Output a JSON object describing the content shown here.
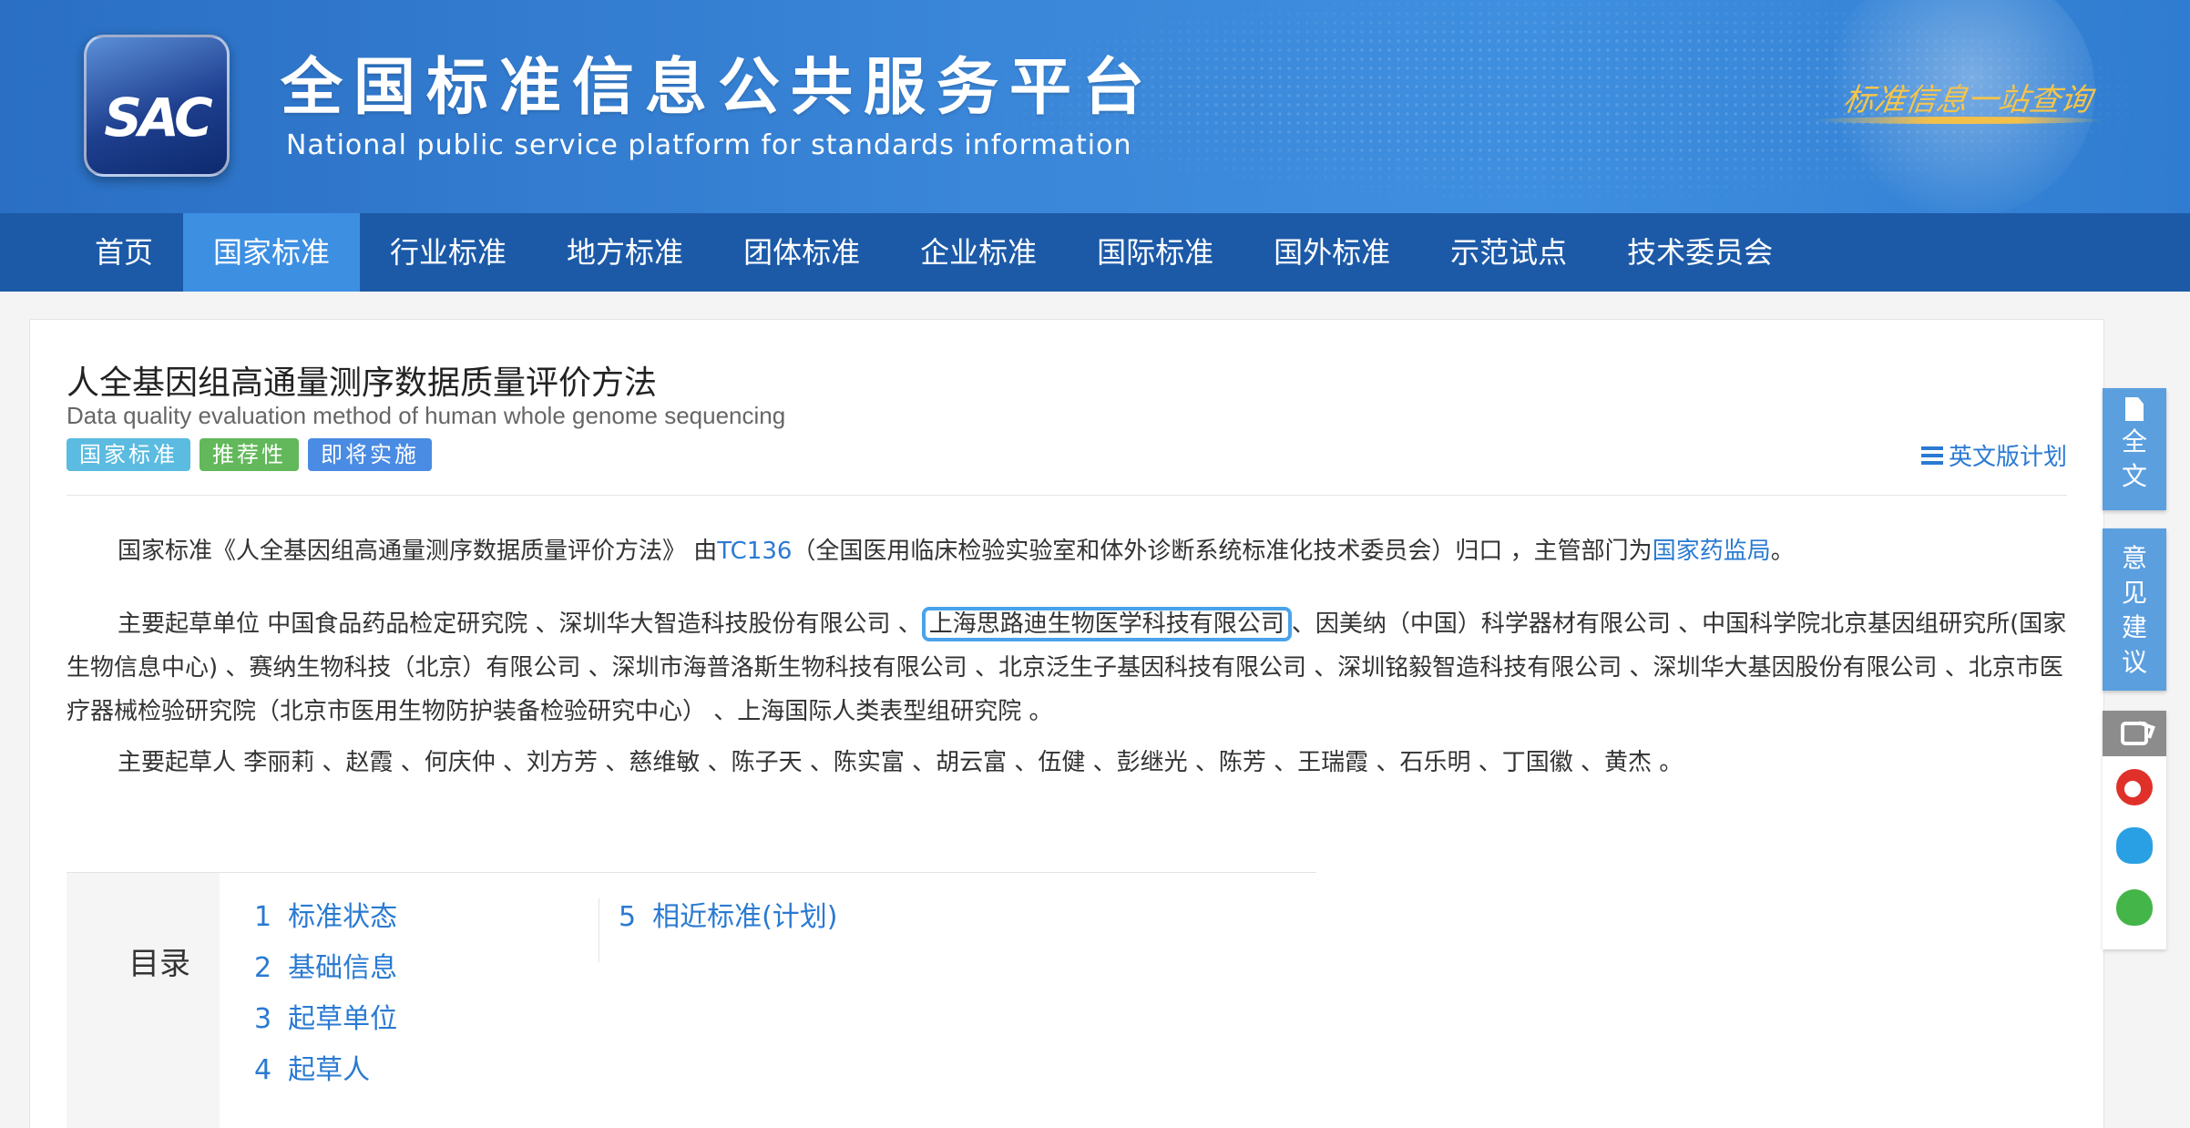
{
  "header": {
    "logo_text": "SAC",
    "title": "全国标准信息公共服务平台",
    "subtitle": "National public service platform  for standards information",
    "slogan": "标准信息一站查询"
  },
  "nav": {
    "items": [
      "首页",
      "国家标准",
      "行业标准",
      "地方标准",
      "团体标准",
      "企业标准",
      "国际标准",
      "国外标准",
      "示范试点",
      "技术委员会"
    ],
    "active_index": 1
  },
  "standard": {
    "title_cn": "人全基因组高通量测序数据质量评价方法",
    "title_en": "Data quality evaluation method of human whole genome sequencing",
    "tags": [
      "国家标准",
      "推荐性",
      "即将实施"
    ],
    "en_plan_label": "英文版计划"
  },
  "intro": {
    "p1_before": "国家标准《人全基因组高通量测序数据质量评价方法》 由",
    "p1_tc_link": "TC136",
    "p1_middle": "（全国医用临床检验实验室和体外诊断系统标准化技术委员会）归口 ，主管部门为",
    "p1_dept_link": "国家药监局",
    "p1_after": "。",
    "p2_before": "主要起草单位 中国食品药品检定研究院 、深圳华大智造科技股份有限公司 、",
    "p2_highlight": "上海思路迪生物医学科技有限公司",
    "p2_after": "、因美纳（中国）科学器材有限公司 、中国科学院北京基因组研究所(国家生物信息中心) 、赛纳生物科技（北京）有限公司 、深圳市海普洛斯生物科技有限公司 、北京泛生子基因科技有限公司 、深圳铭毅智造科技有限公司 、深圳华大基因股份有限公司 、北京市医疗器械检验研究院（北京市医用生物防护装备检验研究中心） 、上海国际人类表型组研究院 。",
    "p3": "主要起草人 李丽莉 、赵霞 、何庆仲 、刘方芳 、慈维敏 、陈子天 、陈实富 、胡云富 、伍健 、彭继光 、陈芳 、王瑞霞 、石乐明 、丁国徽 、黄杰 。"
  },
  "toc": {
    "label": "目录",
    "col1": [
      {
        "num": "1",
        "text": "标准状态"
      },
      {
        "num": "2",
        "text": "基础信息"
      },
      {
        "num": "3",
        "text": "起草单位"
      },
      {
        "num": "4",
        "text": "起草人"
      }
    ],
    "col2": [
      {
        "num": "5",
        "text": "相近标准(计划)"
      }
    ]
  },
  "side": {
    "full_text": [
      "全",
      "文"
    ],
    "feedback": [
      "意",
      "见",
      "建",
      "议"
    ]
  }
}
